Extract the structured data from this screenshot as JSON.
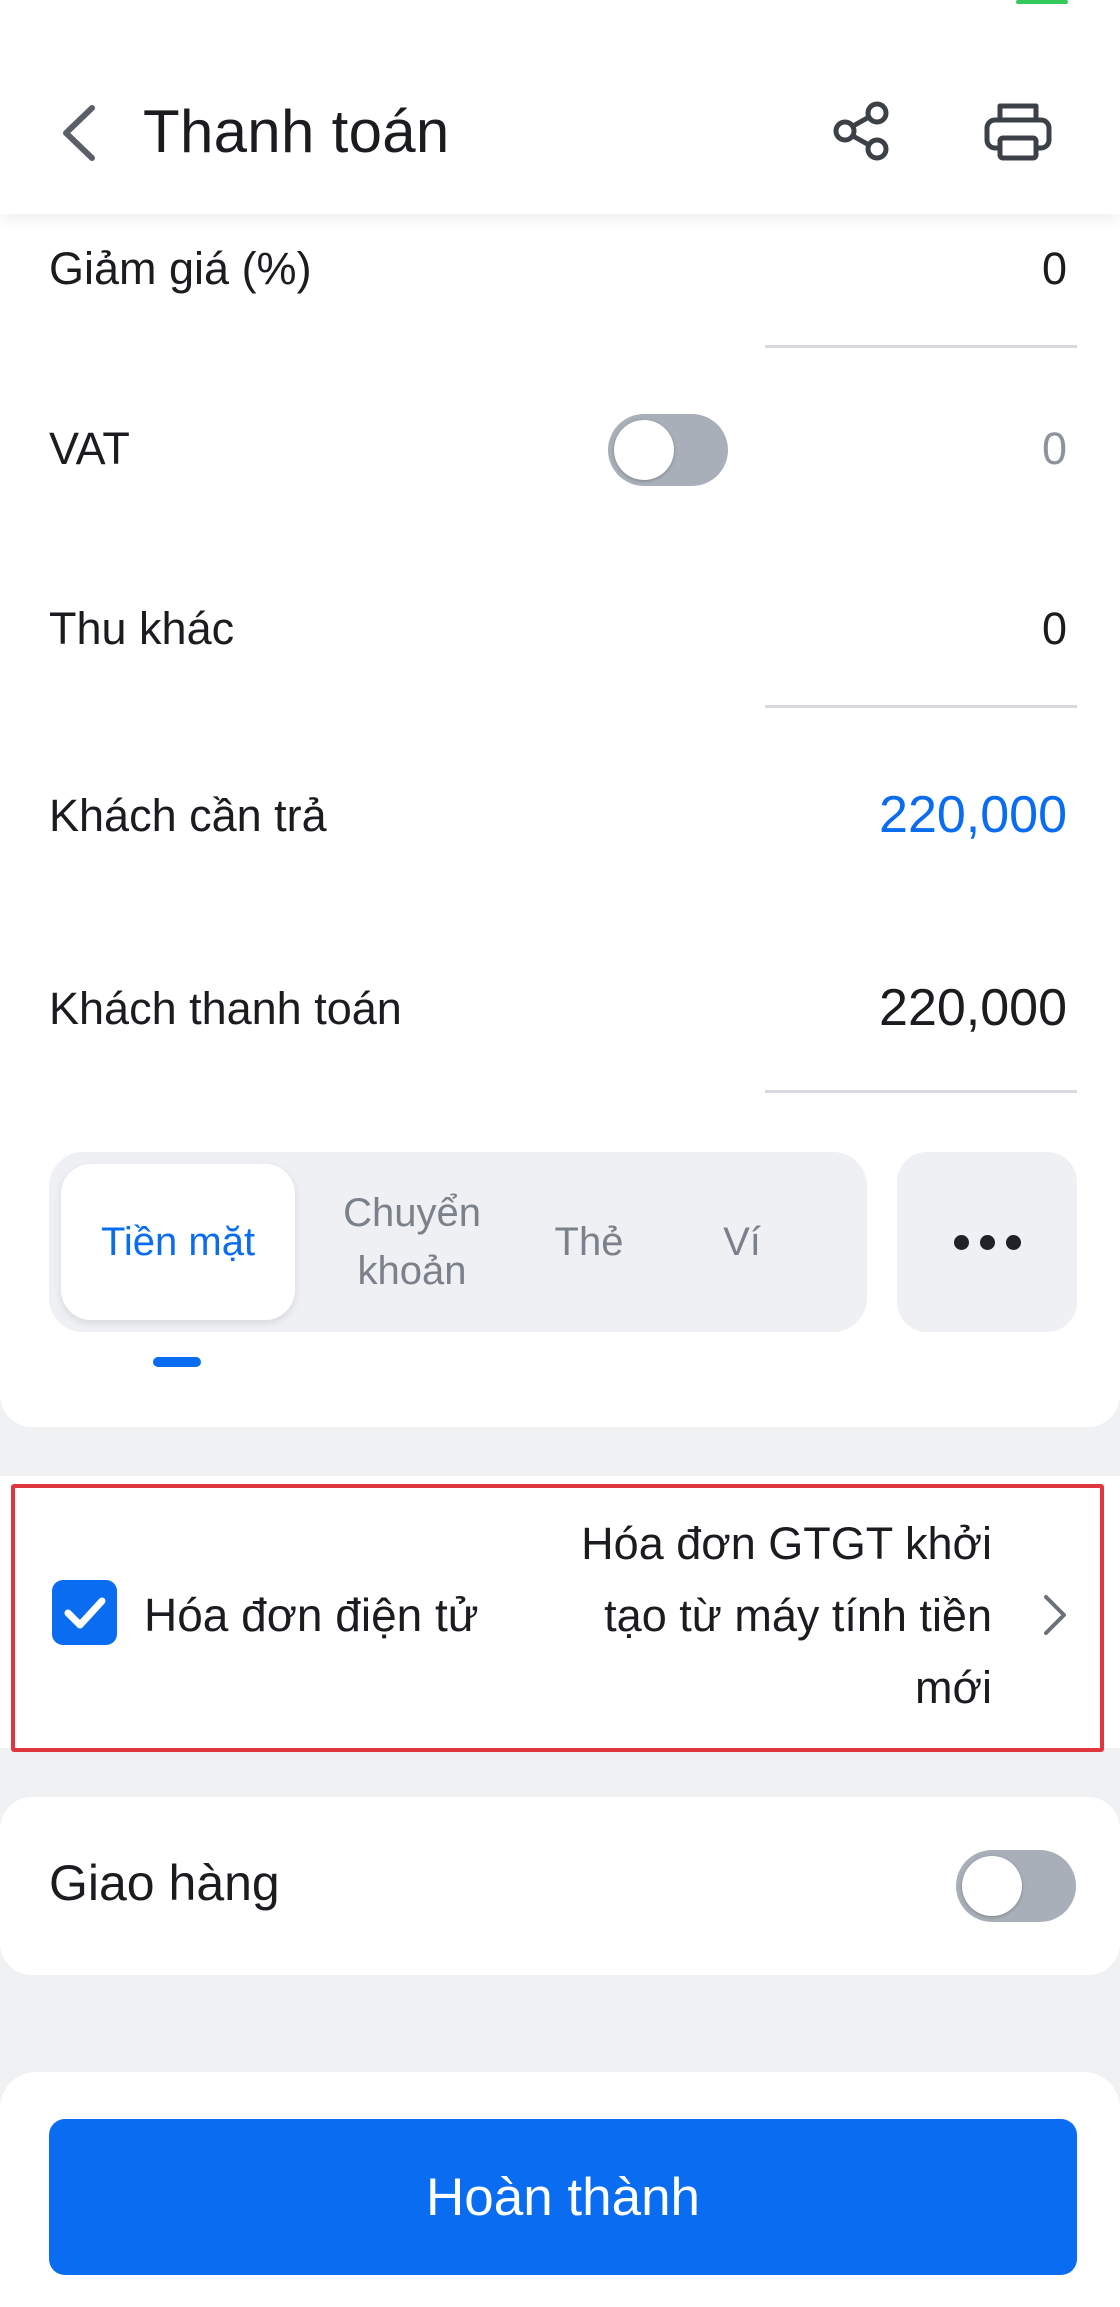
{
  "header": {
    "title": "Thanh toán",
    "back_icon": "chevron-left-icon",
    "share_icon": "share-icon",
    "print_icon": "printer-icon"
  },
  "payment": {
    "discount": {
      "label": "Giảm giá (%)",
      "value": "0"
    },
    "vat": {
      "label": "VAT",
      "value": "0",
      "enabled": false
    },
    "other_charges": {
      "label": "Thu khác",
      "value": "0"
    },
    "amount_due": {
      "label": "Khách cần trả",
      "value": "220,000"
    },
    "customer_paid": {
      "label": "Khách thanh toán",
      "value": "220,000"
    },
    "methods": [
      {
        "label": "Tiền mặt",
        "selected": true
      },
      {
        "label": "Chuyển khoản",
        "selected": false
      },
      {
        "label": "Thẻ",
        "selected": false
      },
      {
        "label": "Ví",
        "selected": false
      }
    ],
    "more_icon": "more-horizontal-icon"
  },
  "invoice": {
    "checked": true,
    "label": "Hóa đơn điện tử",
    "template": "Hóa đơn GTGT khởi tạo từ máy tính tiền mới"
  },
  "delivery": {
    "label": "Giao hàng",
    "enabled": false
  },
  "footer": {
    "complete_label": "Hoàn thành"
  },
  "colors": {
    "accent": "#0a6cf0",
    "highlight_border": "#e0363e",
    "toggle_off": "#a9afb8"
  }
}
